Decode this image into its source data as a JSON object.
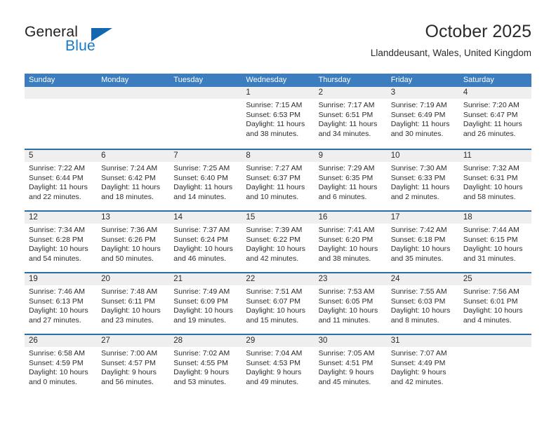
{
  "brand": {
    "name_top": "General",
    "name_bottom": "Blue",
    "triangle_color": "#1566b0",
    "blue_color": "#1878c8"
  },
  "header": {
    "title": "October 2025",
    "subtitle": "Llanddeusant, Wales, United Kingdom"
  },
  "theme": {
    "header_blue": "#3b7dbf",
    "rule_blue": "#2e6da4",
    "day_strip_gray": "#efefef",
    "text_color": "#2b2b2b"
  },
  "weekdays": [
    "Sunday",
    "Monday",
    "Tuesday",
    "Wednesday",
    "Thursday",
    "Friday",
    "Saturday"
  ],
  "weeks": [
    [
      {
        "day": "",
        "sunrise": "",
        "sunset": "",
        "daylight_line1": "",
        "daylight_line2": ""
      },
      {
        "day": "",
        "sunrise": "",
        "sunset": "",
        "daylight_line1": "",
        "daylight_line2": ""
      },
      {
        "day": "",
        "sunrise": "",
        "sunset": "",
        "daylight_line1": "",
        "daylight_line2": ""
      },
      {
        "day": "1",
        "sunrise": "Sunrise: 7:15 AM",
        "sunset": "Sunset: 6:53 PM",
        "daylight_line1": "Daylight: 11 hours",
        "daylight_line2": "and 38 minutes."
      },
      {
        "day": "2",
        "sunrise": "Sunrise: 7:17 AM",
        "sunset": "Sunset: 6:51 PM",
        "daylight_line1": "Daylight: 11 hours",
        "daylight_line2": "and 34 minutes."
      },
      {
        "day": "3",
        "sunrise": "Sunrise: 7:19 AM",
        "sunset": "Sunset: 6:49 PM",
        "daylight_line1": "Daylight: 11 hours",
        "daylight_line2": "and 30 minutes."
      },
      {
        "day": "4",
        "sunrise": "Sunrise: 7:20 AM",
        "sunset": "Sunset: 6:47 PM",
        "daylight_line1": "Daylight: 11 hours",
        "daylight_line2": "and 26 minutes."
      }
    ],
    [
      {
        "day": "5",
        "sunrise": "Sunrise: 7:22 AM",
        "sunset": "Sunset: 6:44 PM",
        "daylight_line1": "Daylight: 11 hours",
        "daylight_line2": "and 22 minutes."
      },
      {
        "day": "6",
        "sunrise": "Sunrise: 7:24 AM",
        "sunset": "Sunset: 6:42 PM",
        "daylight_line1": "Daylight: 11 hours",
        "daylight_line2": "and 18 minutes."
      },
      {
        "day": "7",
        "sunrise": "Sunrise: 7:25 AM",
        "sunset": "Sunset: 6:40 PM",
        "daylight_line1": "Daylight: 11 hours",
        "daylight_line2": "and 14 minutes."
      },
      {
        "day": "8",
        "sunrise": "Sunrise: 7:27 AM",
        "sunset": "Sunset: 6:37 PM",
        "daylight_line1": "Daylight: 11 hours",
        "daylight_line2": "and 10 minutes."
      },
      {
        "day": "9",
        "sunrise": "Sunrise: 7:29 AM",
        "sunset": "Sunset: 6:35 PM",
        "daylight_line1": "Daylight: 11 hours",
        "daylight_line2": "and 6 minutes."
      },
      {
        "day": "10",
        "sunrise": "Sunrise: 7:30 AM",
        "sunset": "Sunset: 6:33 PM",
        "daylight_line1": "Daylight: 11 hours",
        "daylight_line2": "and 2 minutes."
      },
      {
        "day": "11",
        "sunrise": "Sunrise: 7:32 AM",
        "sunset": "Sunset: 6:31 PM",
        "daylight_line1": "Daylight: 10 hours",
        "daylight_line2": "and 58 minutes."
      }
    ],
    [
      {
        "day": "12",
        "sunrise": "Sunrise: 7:34 AM",
        "sunset": "Sunset: 6:28 PM",
        "daylight_line1": "Daylight: 10 hours",
        "daylight_line2": "and 54 minutes."
      },
      {
        "day": "13",
        "sunrise": "Sunrise: 7:36 AM",
        "sunset": "Sunset: 6:26 PM",
        "daylight_line1": "Daylight: 10 hours",
        "daylight_line2": "and 50 minutes."
      },
      {
        "day": "14",
        "sunrise": "Sunrise: 7:37 AM",
        "sunset": "Sunset: 6:24 PM",
        "daylight_line1": "Daylight: 10 hours",
        "daylight_line2": "and 46 minutes."
      },
      {
        "day": "15",
        "sunrise": "Sunrise: 7:39 AM",
        "sunset": "Sunset: 6:22 PM",
        "daylight_line1": "Daylight: 10 hours",
        "daylight_line2": "and 42 minutes."
      },
      {
        "day": "16",
        "sunrise": "Sunrise: 7:41 AM",
        "sunset": "Sunset: 6:20 PM",
        "daylight_line1": "Daylight: 10 hours",
        "daylight_line2": "and 38 minutes."
      },
      {
        "day": "17",
        "sunrise": "Sunrise: 7:42 AM",
        "sunset": "Sunset: 6:18 PM",
        "daylight_line1": "Daylight: 10 hours",
        "daylight_line2": "and 35 minutes."
      },
      {
        "day": "18",
        "sunrise": "Sunrise: 7:44 AM",
        "sunset": "Sunset: 6:15 PM",
        "daylight_line1": "Daylight: 10 hours",
        "daylight_line2": "and 31 minutes."
      }
    ],
    [
      {
        "day": "19",
        "sunrise": "Sunrise: 7:46 AM",
        "sunset": "Sunset: 6:13 PM",
        "daylight_line1": "Daylight: 10 hours",
        "daylight_line2": "and 27 minutes."
      },
      {
        "day": "20",
        "sunrise": "Sunrise: 7:48 AM",
        "sunset": "Sunset: 6:11 PM",
        "daylight_line1": "Daylight: 10 hours",
        "daylight_line2": "and 23 minutes."
      },
      {
        "day": "21",
        "sunrise": "Sunrise: 7:49 AM",
        "sunset": "Sunset: 6:09 PM",
        "daylight_line1": "Daylight: 10 hours",
        "daylight_line2": "and 19 minutes."
      },
      {
        "day": "22",
        "sunrise": "Sunrise: 7:51 AM",
        "sunset": "Sunset: 6:07 PM",
        "daylight_line1": "Daylight: 10 hours",
        "daylight_line2": "and 15 minutes."
      },
      {
        "day": "23",
        "sunrise": "Sunrise: 7:53 AM",
        "sunset": "Sunset: 6:05 PM",
        "daylight_line1": "Daylight: 10 hours",
        "daylight_line2": "and 11 minutes."
      },
      {
        "day": "24",
        "sunrise": "Sunrise: 7:55 AM",
        "sunset": "Sunset: 6:03 PM",
        "daylight_line1": "Daylight: 10 hours",
        "daylight_line2": "and 8 minutes."
      },
      {
        "day": "25",
        "sunrise": "Sunrise: 7:56 AM",
        "sunset": "Sunset: 6:01 PM",
        "daylight_line1": "Daylight: 10 hours",
        "daylight_line2": "and 4 minutes."
      }
    ],
    [
      {
        "day": "26",
        "sunrise": "Sunrise: 6:58 AM",
        "sunset": "Sunset: 4:59 PM",
        "daylight_line1": "Daylight: 10 hours",
        "daylight_line2": "and 0 minutes."
      },
      {
        "day": "27",
        "sunrise": "Sunrise: 7:00 AM",
        "sunset": "Sunset: 4:57 PM",
        "daylight_line1": "Daylight: 9 hours",
        "daylight_line2": "and 56 minutes."
      },
      {
        "day": "28",
        "sunrise": "Sunrise: 7:02 AM",
        "sunset": "Sunset: 4:55 PM",
        "daylight_line1": "Daylight: 9 hours",
        "daylight_line2": "and 53 minutes."
      },
      {
        "day": "29",
        "sunrise": "Sunrise: 7:04 AM",
        "sunset": "Sunset: 4:53 PM",
        "daylight_line1": "Daylight: 9 hours",
        "daylight_line2": "and 49 minutes."
      },
      {
        "day": "30",
        "sunrise": "Sunrise: 7:05 AM",
        "sunset": "Sunset: 4:51 PM",
        "daylight_line1": "Daylight: 9 hours",
        "daylight_line2": "and 45 minutes."
      },
      {
        "day": "31",
        "sunrise": "Sunrise: 7:07 AM",
        "sunset": "Sunset: 4:49 PM",
        "daylight_line1": "Daylight: 9 hours",
        "daylight_line2": "and 42 minutes."
      },
      {
        "day": "",
        "sunrise": "",
        "sunset": "",
        "daylight_line1": "",
        "daylight_line2": ""
      }
    ]
  ]
}
